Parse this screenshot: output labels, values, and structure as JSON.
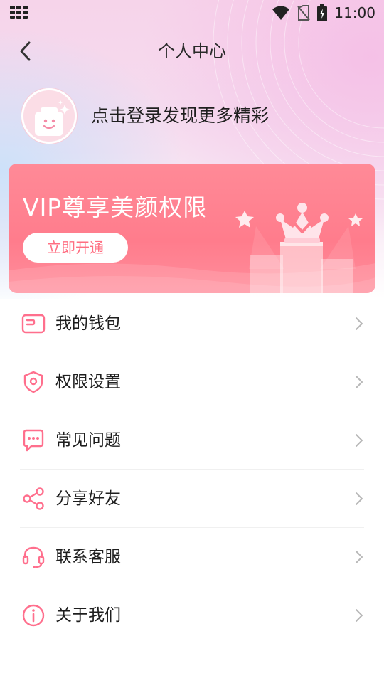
{
  "status_bar": {
    "time": "11:00"
  },
  "header": {
    "title": "个人中心"
  },
  "profile": {
    "login_prompt": "点击登录发现更多精彩"
  },
  "vip": {
    "title": "VIP尊享美颜权限",
    "button_label": "立即开通"
  },
  "menu": [
    {
      "label": "我的钱包",
      "icon": "wallet-icon"
    },
    {
      "label": "权限设置",
      "icon": "shield-icon"
    },
    {
      "label": "常见问题",
      "icon": "chat-bubble-icon"
    },
    {
      "label": "分享好友",
      "icon": "share-icon"
    },
    {
      "label": "联系客服",
      "icon": "headset-icon"
    },
    {
      "label": "关于我们",
      "icon": "info-icon"
    }
  ],
  "colors": {
    "accent": "#ff6f8d",
    "vip_banner": "#ff7c8c"
  }
}
